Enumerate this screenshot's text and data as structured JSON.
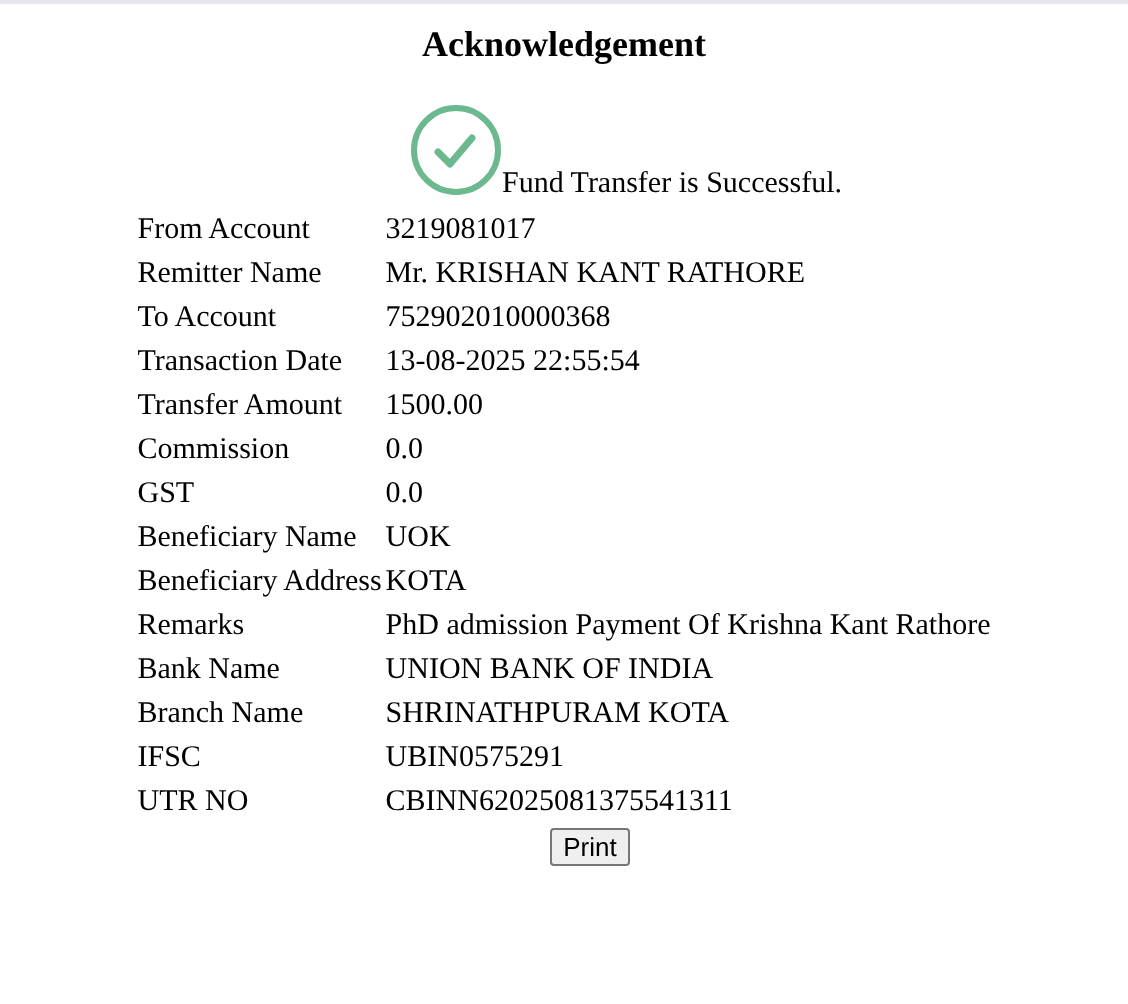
{
  "title": "Acknowledgement",
  "status": {
    "message": "Fund Transfer is Successful."
  },
  "details": [
    {
      "label": "From Account",
      "value": "3219081017"
    },
    {
      "label": "Remitter Name",
      "value": "Mr. KRISHAN KANT RATHORE"
    },
    {
      "label": "To Account",
      "value": "752902010000368"
    },
    {
      "label": "Transaction Date",
      "value": "13-08-2025 22:55:54"
    },
    {
      "label": "Transfer Amount",
      "value": "1500.00"
    },
    {
      "label": "Commission",
      "value": "0.0"
    },
    {
      "label": "GST",
      "value": "0.0"
    },
    {
      "label": "Beneficiary Name",
      "value": "UOK"
    },
    {
      "label": "Beneficiary Address",
      "value": "KOTA"
    },
    {
      "label": "Remarks",
      "value": "PhD admission Payment Of Krishna Kant Rathore"
    },
    {
      "label": "Bank Name",
      "value": "UNION BANK OF INDIA"
    },
    {
      "label": "Branch Name",
      "value": "SHRINATHPURAM KOTA"
    },
    {
      "label": "IFSC",
      "value": "UBIN0575291"
    },
    {
      "label": "UTR NO",
      "value": "CBINN62025081375541311"
    }
  ],
  "print_button": "Print"
}
